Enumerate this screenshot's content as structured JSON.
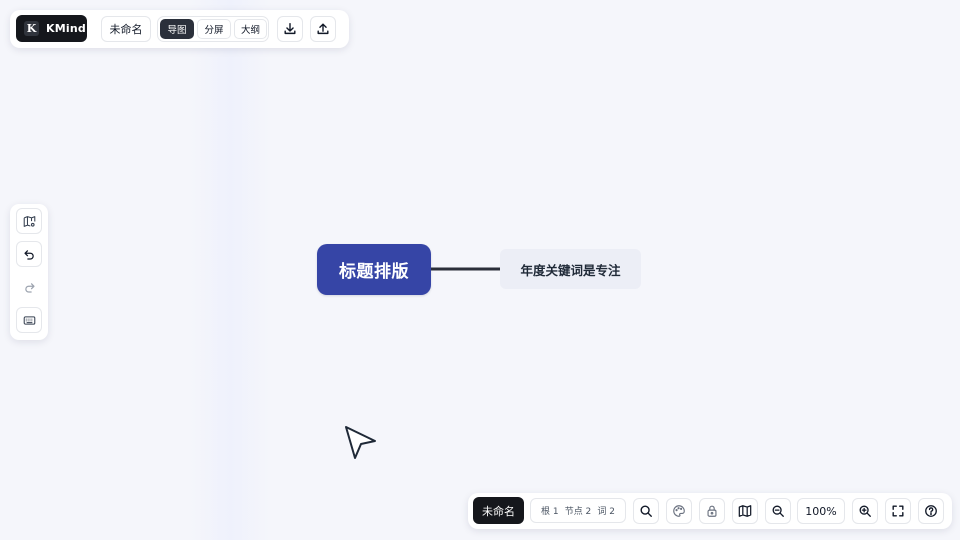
{
  "app": {
    "logo_letter": "K",
    "name": "KMind"
  },
  "topbar": {
    "document_name": "未命名",
    "view_modes": [
      {
        "label": "导图",
        "active": true
      },
      {
        "label": "分屏",
        "active": false
      },
      {
        "label": "大纲",
        "active": false
      }
    ],
    "actions": [
      {
        "icon": "download-icon"
      },
      {
        "icon": "upload-icon"
      }
    ]
  },
  "leftbar": {
    "tools": [
      {
        "icon": "map-settings-icon"
      },
      {
        "icon": "undo-icon"
      },
      {
        "icon": "redo-icon"
      },
      {
        "icon": "keyboard-icon"
      }
    ]
  },
  "mindmap": {
    "root": {
      "text": "标题排版",
      "color": "#3645a6"
    },
    "children": [
      {
        "text": "年度关键词是专注",
        "color": "#eceef6"
      }
    ],
    "link_color": "#2b2f3a"
  },
  "bottombar": {
    "document_name": "未命名",
    "stats": {
      "root": "根 1",
      "nodes": "节点 2",
      "words": "词 2"
    },
    "tools": [
      {
        "icon": "search-icon"
      },
      {
        "icon": "palette-icon"
      },
      {
        "icon": "lock-icon"
      },
      {
        "icon": "map-icon"
      },
      {
        "icon": "zoom-out-icon"
      },
      {
        "icon": "zoom-in-icon"
      },
      {
        "icon": "fullscreen-icon"
      },
      {
        "icon": "help-icon"
      }
    ],
    "zoom": "100%"
  },
  "colors": {
    "canvas": "#f5f6fb",
    "accent": "#3645a6",
    "dark": "#15171c"
  }
}
